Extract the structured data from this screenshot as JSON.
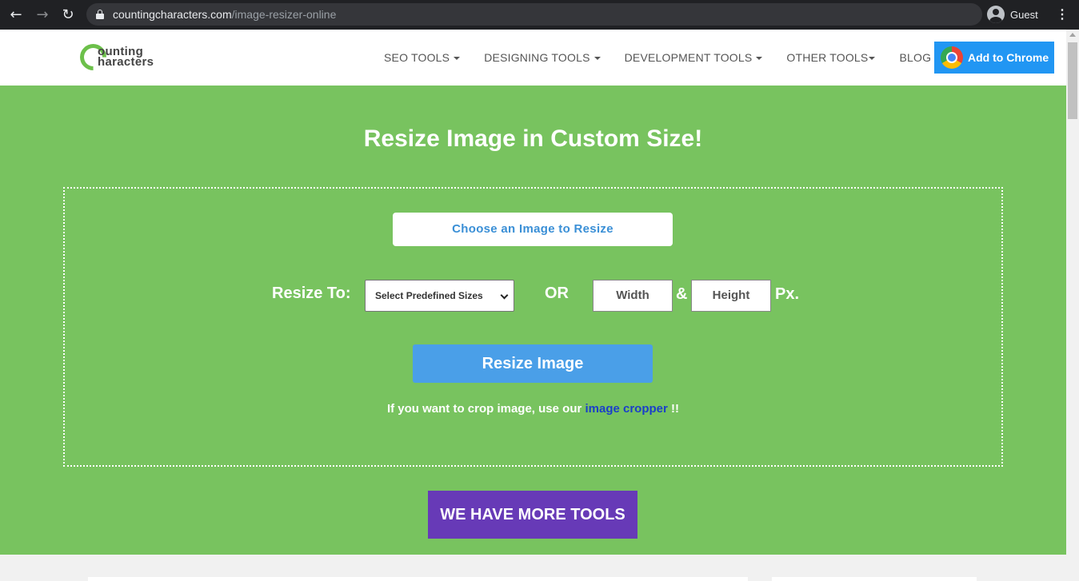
{
  "browser": {
    "url_domain": "countingcharacters.com",
    "url_path": "/image-resizer-online",
    "profile_label": "Guest"
  },
  "header": {
    "logo_line1": "ounting",
    "logo_line2": "haracters",
    "menu": [
      {
        "label": "SEO TOOLS",
        "dropdown": true
      },
      {
        "label": "DESIGNING TOOLS",
        "dropdown": true
      },
      {
        "label": "DEVELOPMENT TOOLS",
        "dropdown": true
      },
      {
        "label": "OTHER TOOLS",
        "dropdown": true
      },
      {
        "label": "BLOG",
        "dropdown": false
      }
    ],
    "add_to_chrome": "Add to Chrome"
  },
  "hero": {
    "title": "Resize Image in Custom Size!",
    "choose_button": "Choose an Image to Resize",
    "resize_to_label": "Resize To:",
    "size_select_value": "Select Predefined Sizes",
    "or_label": "OR",
    "width_placeholder": "Width",
    "amp": "&",
    "height_placeholder": "Height",
    "px_label": "Px.",
    "resize_button": "Resize Image",
    "crop_note_prefix": "If you want to crop image, use our ",
    "crop_link": "image cropper",
    "crop_note_suffix": " !!",
    "more_tools_button": "WE HAVE MORE TOOLS"
  },
  "colors": {
    "hero_green": "#78c35f",
    "add_chrome_blue": "#2196f3",
    "resize_button_blue": "#4a9fe8",
    "more_tools_purple": "#673ab7",
    "link_blue": "#1a3fc9"
  }
}
